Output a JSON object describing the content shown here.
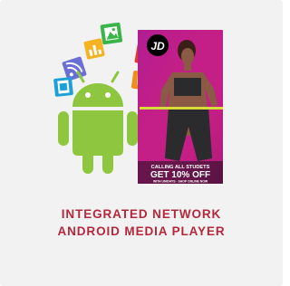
{
  "card": {
    "title_line1": "INTEGRATED NETWORK",
    "title_line2": "ANDROID MEDIA PLAYER"
  },
  "poster": {
    "brand_logo": "JD",
    "headline": "CALLING ALL STUDETS",
    "offer": "GET 10% OFF",
    "fine_print": "WITH UNIDAYS · SHOP ONLINE NOW"
  },
  "colors": {
    "android_green": "#8ec73f",
    "caption_red": "#b5283c",
    "poster_magenta": "#c41f87",
    "card_background": "#f2f2f2"
  },
  "icons": [
    "chart-icon",
    "image-icon",
    "rss-icon",
    "film-icon",
    "text-icon",
    "html-icon"
  ]
}
